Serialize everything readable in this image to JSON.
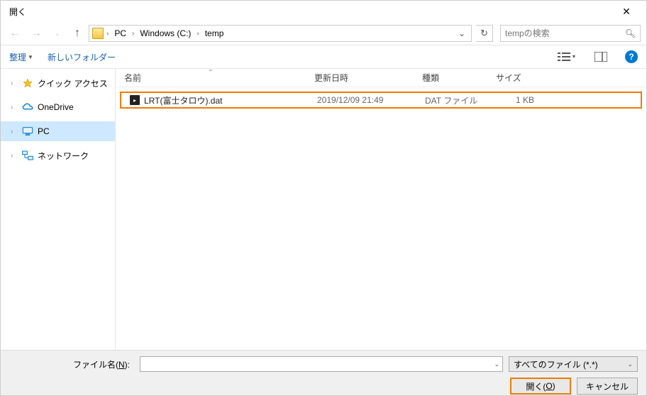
{
  "window": {
    "title": "開く"
  },
  "nav": {
    "breadcrumbs": [
      "PC",
      "Windows (C:)",
      "temp"
    ],
    "search_placeholder": "tempの検索"
  },
  "toolbar": {
    "organize": "整理",
    "new_folder": "新しいフォルダー"
  },
  "sidebar": {
    "items": [
      {
        "label": "クイック アクセス",
        "icon": "star"
      },
      {
        "label": "OneDrive",
        "icon": "cloud"
      },
      {
        "label": "PC",
        "icon": "pc",
        "selected": true
      },
      {
        "label": "ネットワーク",
        "icon": "network"
      }
    ]
  },
  "columns": {
    "name": "名前",
    "date": "更新日時",
    "type": "種類",
    "size": "サイズ"
  },
  "files": [
    {
      "name": "LRT(富士タロウ).dat",
      "date": "2019/12/09 21:49",
      "type": "DAT ファイル",
      "size": "1 KB"
    }
  ],
  "footer": {
    "filename_label_pre": "ファイル名(",
    "filename_label_u": "N",
    "filename_label_post": "):",
    "filename_value": "",
    "filter": "すべてのファイル (*.*)",
    "open_pre": "開く(",
    "open_u": "O",
    "open_post": ")",
    "cancel": "キャンセル"
  }
}
